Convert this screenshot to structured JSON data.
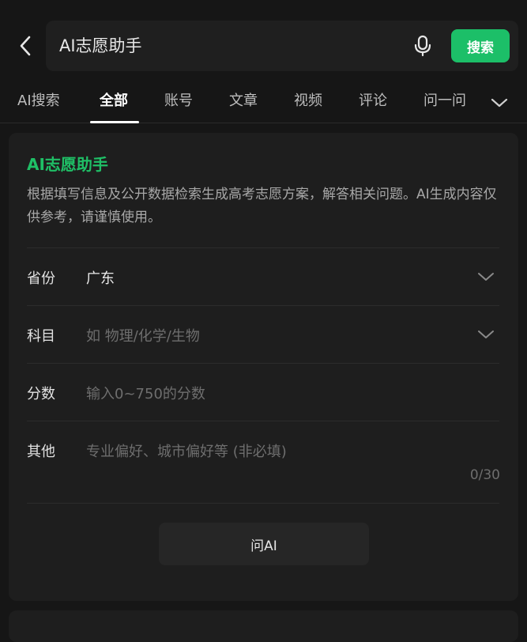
{
  "search": {
    "value": "AI志愿助手",
    "button_label": "搜索"
  },
  "tabs": [
    {
      "label": "AI搜索",
      "active": false
    },
    {
      "label": "全部",
      "active": true
    },
    {
      "label": "账号",
      "active": false
    },
    {
      "label": "文章",
      "active": false
    },
    {
      "label": "视频",
      "active": false
    },
    {
      "label": "评论",
      "active": false
    },
    {
      "label": "问一问",
      "active": false
    }
  ],
  "card": {
    "title": "AI志愿助手",
    "description": "根据填写信息及公开数据检索生成高考志愿方案，解答相关问题。AI生成内容仅供参考，请谨慎使用。",
    "fields": {
      "province": {
        "label": "省份",
        "value": "广东"
      },
      "subject": {
        "label": "科目",
        "placeholder": "如 物理/化学/生物"
      },
      "score": {
        "label": "分数",
        "placeholder": "输入0~750的分数"
      },
      "other": {
        "label": "其他",
        "placeholder": "专业偏好、城市偏好等 (非必填)",
        "counter": "0/30"
      }
    },
    "ask_button_label": "问AI"
  },
  "colors": {
    "background": "#161616",
    "card": "#1e1e1e",
    "accent_green": "#1cbf68"
  },
  "icons": {
    "back": "back-arrow-icon",
    "mic": "microphone-icon",
    "more_tabs": "chevron-down-icon"
  }
}
